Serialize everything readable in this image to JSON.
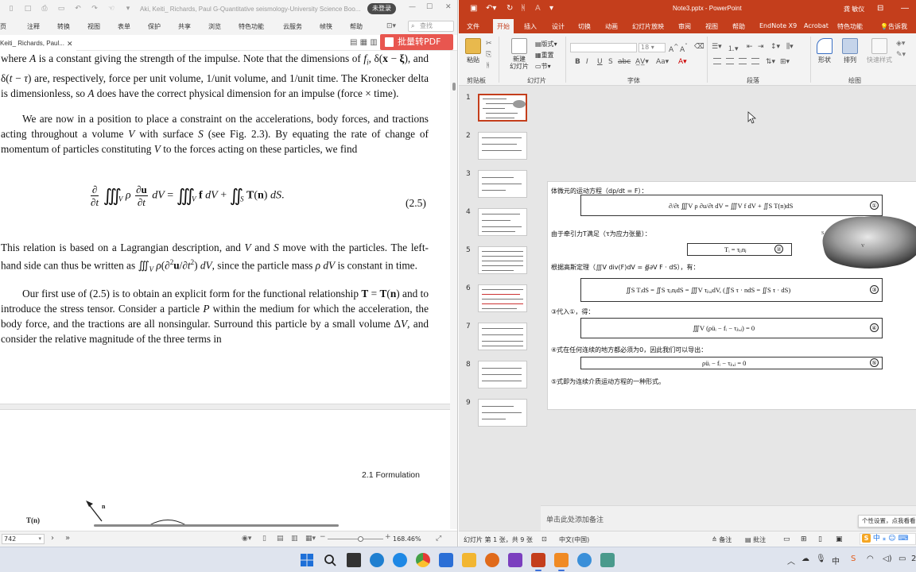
{
  "pdf": {
    "title_icons": [
      "▯",
      "□",
      "▭",
      "⎙",
      "□",
      "↶",
      "↷",
      "⎊",
      "▾"
    ],
    "doc_title": "Aki, Keiti_ Richards, Paul G-Quantitative seismology-University Science Boo...",
    "login_label": "未登录",
    "menu": [
      "页",
      "注释",
      "转换",
      "视图",
      "表单",
      "保护",
      "共享",
      "浏览",
      "特色功能",
      "云服务",
      "帧筷",
      "帮助"
    ],
    "search_placeholder": "查找",
    "tab_label": "Keiti_ Richards, Paul...",
    "batch_pdf_label": "批量转PDF",
    "paragraphs": [
      "where A is a constant giving the strength of the impulse. Note that the dimensions of f_i, δ(x − ξ), and δ(t − τ) are, respectively, force per unit volume, 1/unit volume, and 1/unit time. The Kronecker delta is dimensionless, so A does have the correct physical dimension for an impulse (force × time).",
      "We are now in a position to place a constraint on the accelerations, body forces, and tractions acting throughout a volume V with surface S (see Fig. 2.3). By equating the rate of change of momentum of particles constituting V to the forces acting on these particles, we find",
      "This relation is based on a Lagrangian description, and V and S move with the particles. The left-hand side can thus be written as ∭V ρ(∂²u/∂t²) dV, since the particle mass ρ dV is constant in time.",
      "Our first use of (2.5) is to obtain an explicit form for the functional relationship T = T(n) and to introduce the stress tensor. Consider a particle P within the medium for which the acceleration, the body force, and the tractions are all nonsingular. Surround this particle by a small volume ΔV, and consider the relative magnitude of the three terms in"
    ],
    "equation_number": "(2.5)",
    "running_head": "2.1   Formulation",
    "figure_label_n": "n",
    "figure_label_T": "T(n)",
    "page_input": "742",
    "zoom": "168.46%"
  },
  "ppt": {
    "title": "Note3.pptx - PowerPoint",
    "user": "龚 敏仪",
    "tabs": [
      "文件",
      "开始",
      "插入",
      "设计",
      "切换",
      "动画",
      "幻灯片放映",
      "审阅",
      "视图",
      "帮助",
      "EndNote X9",
      "Acrobat",
      "特色功能",
      "告诉我"
    ],
    "active_tab": "开始",
    "ribbon": {
      "paste": "粘贴",
      "new_slide": "新建\n幻灯片",
      "layout": "版式",
      "reset": "重置",
      "section": "节",
      "font_size": "18",
      "shape": "形状",
      "arrange": "排列",
      "quick_style": "快速样式",
      "groups": [
        "剪贴板",
        "幻灯片",
        "字体",
        "段落",
        "绘图"
      ]
    },
    "thumb_numbers": [
      "1",
      "2",
      "3",
      "4",
      "5",
      "6",
      "7",
      "8",
      "9"
    ],
    "slide": {
      "line1": "体微元的运动方程（dp/dt = F）：",
      "eq1": "∂/∂t ∭V ρ ∂u/∂t dV = ∭V f dV + ∬S T(n)dS",
      "line2": "由于牵引力T满足（τ为应力张量）：",
      "eq2": "Tᵢ = τⱼᵢnⱼ",
      "line3": "根据高斯定理（∭V div(F)dV = ∯∂V F · dS），有：",
      "eq3": "∬S TᵢdS = ∬S τⱼᵢnⱼdS = ∭V τⱼᵢ,ⱼdV,    (∬S τ · ndS = ∬S τ · dS)",
      "line4": "③代入①，得：",
      "eq4": "∭V (ρüᵢ − fᵢ − τⱼᵢ,ⱼ) = 0",
      "line5": "④式在任何连续的地方都必须为0，因此我们可以导出：",
      "eq5": "ρüᵢ − fᵢ − τⱼᵢ,ⱼ = 0",
      "line6": "⑤式即为连续介质运动方程的一种形式。",
      "circ": [
        "①",
        "②",
        "③",
        "④",
        "⑤"
      ],
      "blob_label_s": "S",
      "blob_label_v": "V"
    },
    "notes_placeholder": "单击此处添加备注",
    "status": {
      "slide_info": "幻灯片 第 1 张，共 9 张",
      "language": "中文(中国)",
      "notes": "备注",
      "comments": "批注"
    },
    "tooltip": "个性设置，点我看看",
    "ime": "中"
  },
  "taskbar": {
    "tray_text": "中",
    "tray_date": "2"
  }
}
